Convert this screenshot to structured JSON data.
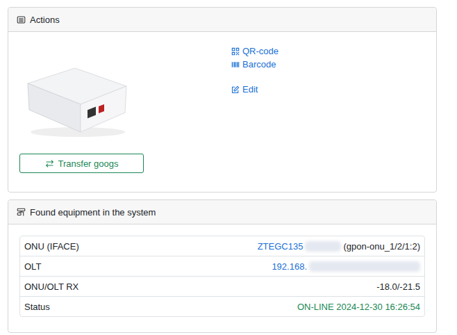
{
  "actions": {
    "title": "Actions",
    "links": [
      {
        "label": "QR-code",
        "icon": "qr"
      },
      {
        "label": "Barcode",
        "icon": "barcode"
      },
      {
        "label": "Edit",
        "icon": "edit"
      }
    ],
    "transfer_button": "Transfer googs"
  },
  "equipment": {
    "title": "Found equipment in the system",
    "rows": [
      {
        "label": "ONU (IFACE)",
        "value": "ZTEGC135",
        "redacted": true,
        "suffix": "(gpon-onu_1/2/1:2)",
        "kind": "link"
      },
      {
        "label": "OLT",
        "value": "192.168.",
        "redacted": true,
        "suffix": "",
        "kind": "link"
      },
      {
        "label": "ONU/OLT RX",
        "value": "-18.0/-21.5",
        "redacted": false,
        "suffix": "",
        "kind": "text"
      },
      {
        "label": "Status",
        "value": "ON-LINE 2024-12-30 16:26:54",
        "redacted": false,
        "suffix": "",
        "kind": "status"
      }
    ]
  }
}
